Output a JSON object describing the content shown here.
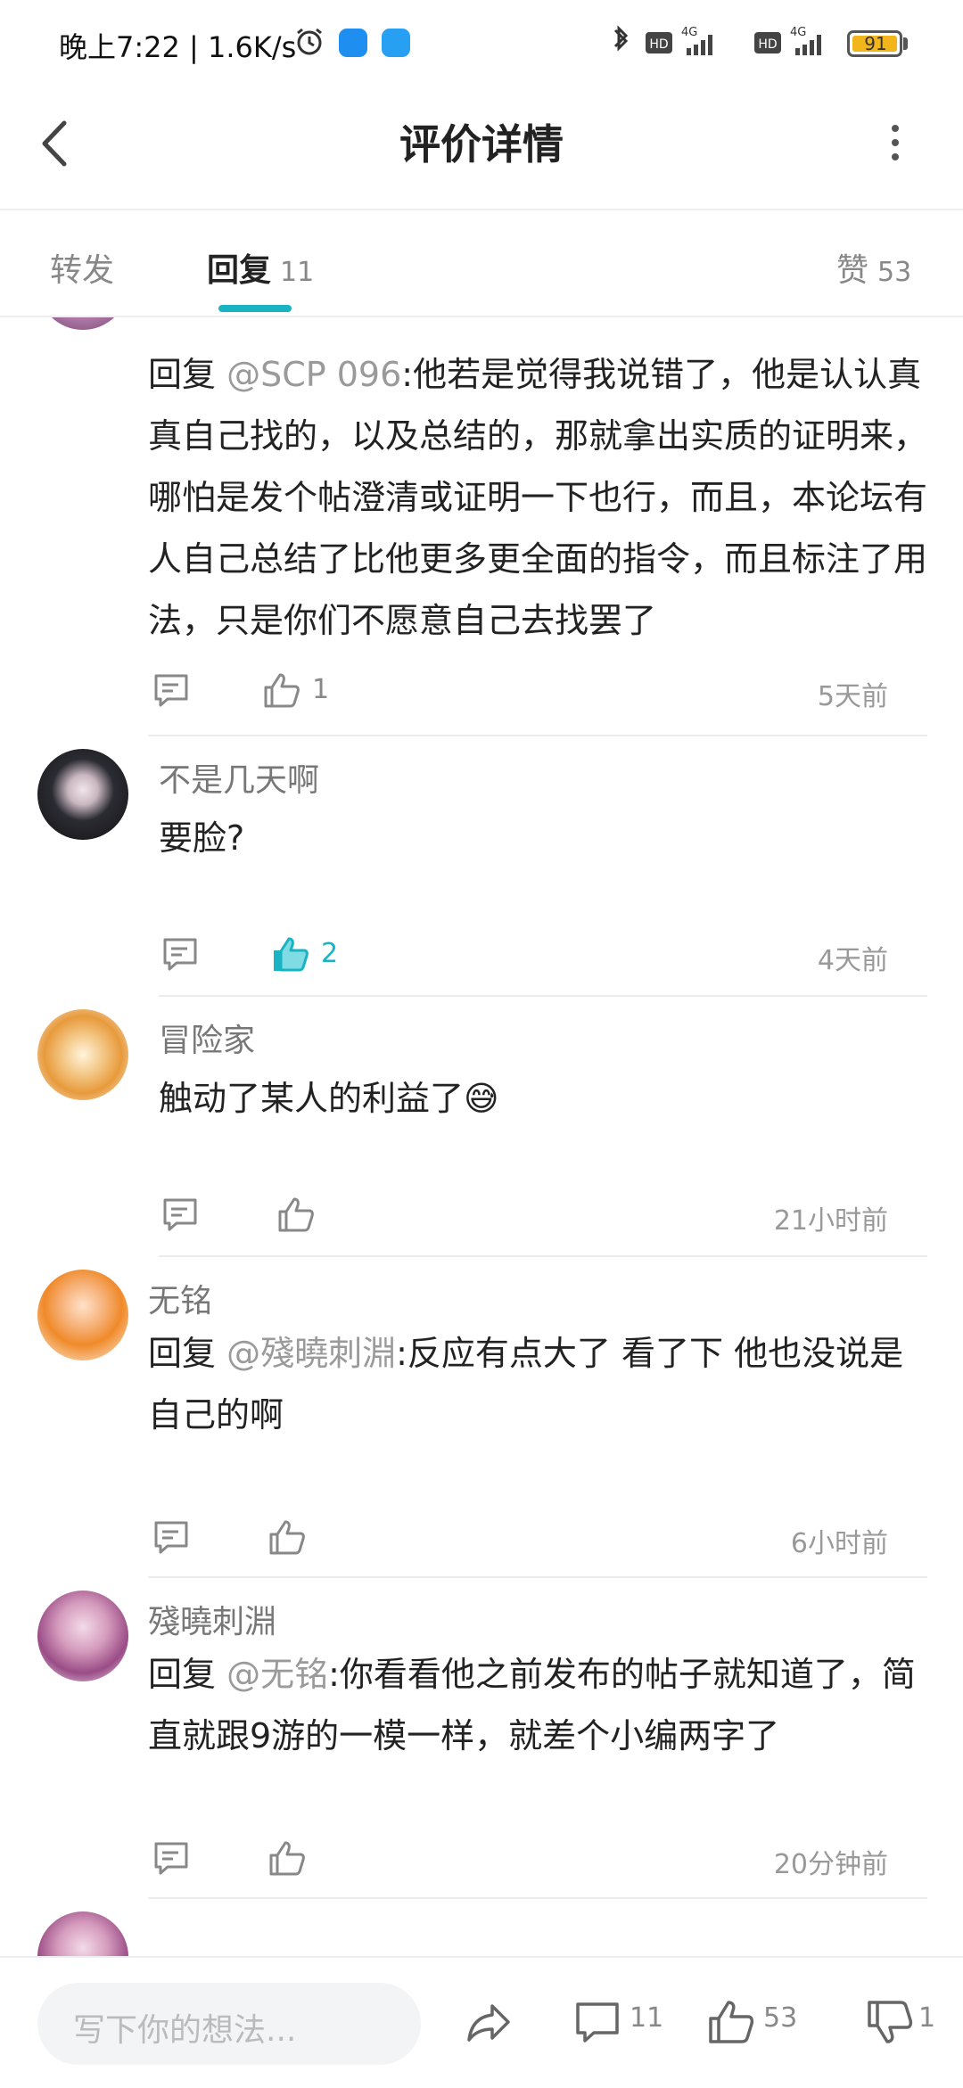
{
  "status_bar": {
    "time": "晚上7:22 | 1.6K/s",
    "battery": "91",
    "network_labels": [
      "HD",
      "4G",
      "HD",
      "4G"
    ]
  },
  "header": {
    "title": "评价详情"
  },
  "tabs": {
    "forward": "转发",
    "reply": "回复",
    "reply_count": "11",
    "like": "赞",
    "like_count": "53"
  },
  "comments": [
    {
      "username": "",
      "reply_prefix": "回复 ",
      "mention": "@SCP 096",
      "text": ":他若是觉得我说错了，他是认认真真自己找的，以及总结的，那就拿出实质的证明来，哪怕是发个帖澄清或证明一下也行，而且，本论坛有人自己总结了比他更多更全面的指令，而且标注了用法，只是你们不愿意自己去找罢了",
      "likes": "1",
      "liked": false,
      "time": "5天前"
    },
    {
      "username": "不是几天啊",
      "reply_prefix": "",
      "mention": "",
      "text": "要脸?",
      "likes": "2",
      "liked": true,
      "time": "4天前"
    },
    {
      "username": "冒险家",
      "reply_prefix": "",
      "mention": "",
      "text": "触动了某人的利益了😅",
      "likes": "",
      "liked": false,
      "time": "21小时前"
    },
    {
      "username": "无铭",
      "reply_prefix": "回复 ",
      "mention": "@殘曉刺淵",
      "text": ":反应有点大了 看了下 他也没说是自己的啊",
      "likes": "",
      "liked": false,
      "time": "6小时前"
    },
    {
      "username": "殘曉刺淵",
      "reply_prefix": "回复 ",
      "mention": "@无铭",
      "text": ":你看看他之前发布的帖子就知道了，简直就跟9游的一模一样，就差个小编两字了",
      "likes": "",
      "liked": false,
      "time": "20分钟前"
    }
  ],
  "bottom_bar": {
    "placeholder": "写下你的想法...",
    "comment_count": "11",
    "like_count": "53",
    "dislike_count": "1"
  },
  "colors": {
    "accent": "#19b3c4",
    "text": "#222222",
    "muted": "#888888"
  },
  "icons": [
    "back-arrow-icon",
    "more-vertical-icon",
    "comment-icon",
    "thumb-up-icon",
    "share-icon",
    "thumb-down-icon",
    "alarm-icon",
    "bluetooth-icon",
    "signal-icon",
    "battery-icon"
  ]
}
